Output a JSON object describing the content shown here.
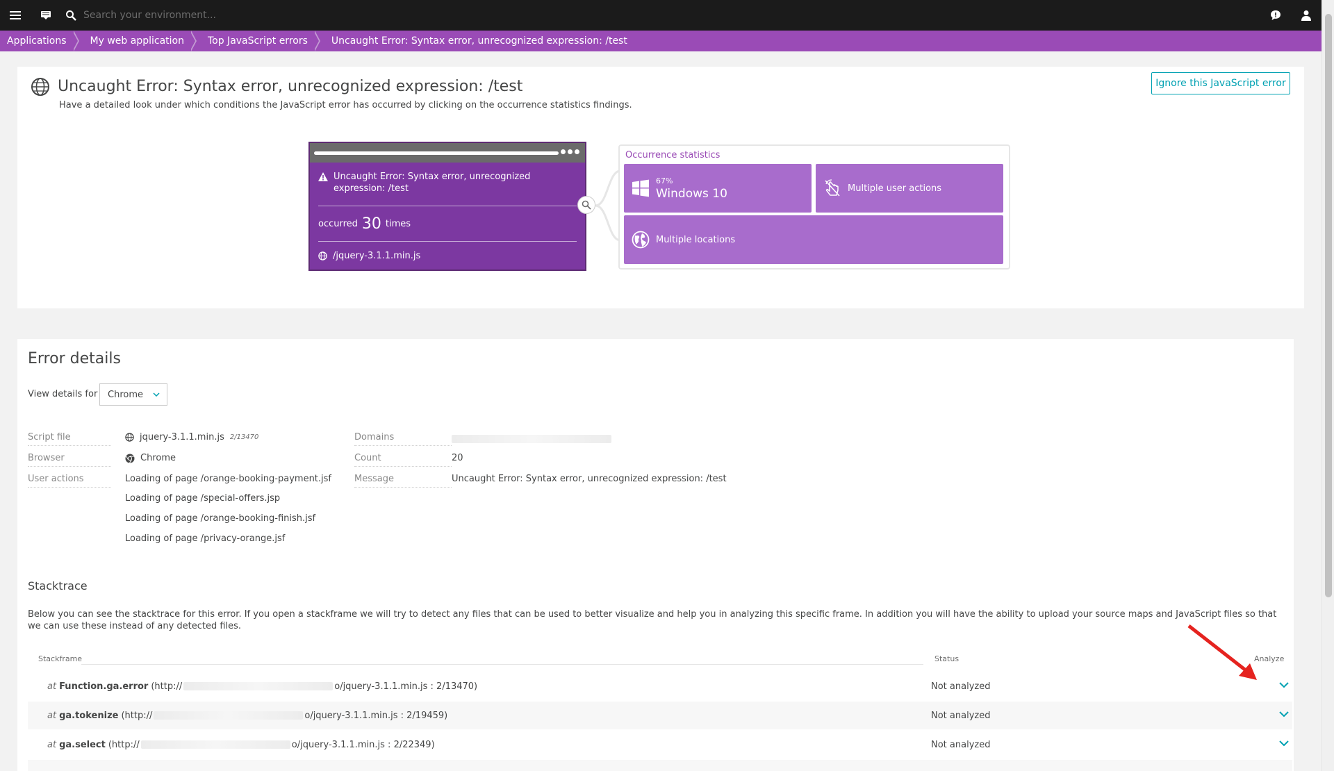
{
  "topbar": {
    "search_placeholder": "Search your environment..."
  },
  "breadcrumb": [
    "Applications",
    "My web application",
    "Top JavaScript errors",
    "Uncaught Error: Syntax error, unrecognized expression: /test"
  ],
  "hero": {
    "title": "Uncaught Error: Syntax error, unrecognized expression: /test",
    "subtitle": "Have a detailed look under which conditions the JavaScript error has occurred by clicking on the occurrence statistics findings.",
    "ignore_label": "Ignore this JavaScript error"
  },
  "browser": {
    "error_text": "Uncaught Error: Syntax error, unrecognized expression: /test",
    "occurred_prefix": "occurred",
    "occurred_count": "30",
    "occurred_suffix": "times",
    "file": "/jquery-3.1.1.min.js"
  },
  "occurrence": {
    "title": "Occurrence statistics",
    "os_percent": "67%",
    "os_name": "Windows 10",
    "user_actions": "Multiple user actions",
    "locations": "Multiple locations"
  },
  "details": {
    "title": "Error details",
    "view_label": "View details for",
    "browser_select": "Chrome",
    "script_file_label": "Script file",
    "script_file": "jquery-3.1.1.min.js",
    "script_file_pos": "2/13470",
    "browser_label": "Browser",
    "browser": "Chrome",
    "user_actions_label": "User actions",
    "user_actions": [
      "Loading of page /orange-booking-payment.jsf",
      "Loading of page /special-offers.jsp",
      "Loading of page /orange-booking-finish.jsf",
      "Loading of page /privacy-orange.jsf"
    ],
    "domains_label": "Domains",
    "count_label": "Count",
    "count": "20",
    "message_label": "Message",
    "message": "Uncaught Error: Syntax error, unrecognized expression: /test"
  },
  "stacktrace": {
    "title": "Stacktrace",
    "description": "Below you can see the stacktrace for this error. If you open a stackframe we will try to detect any files that can be used to better visualize and help you in analyzing this specific frame. In addition you will have the ability to upload your source maps and JavaScript files so that we can use these instead of any detected files.",
    "col_frame": "Stackframe",
    "col_status": "Status",
    "col_analyze": "Analyze",
    "rows": [
      {
        "at": "at",
        "fn": "Function.ga.error",
        "pre": "(http://",
        "post": "o/jquery-3.1.1.min.js : 2/13470)",
        "status": "Not analyzed"
      },
      {
        "at": "at",
        "fn": "ga.tokenize",
        "pre": "(http://",
        "post": "o/jquery-3.1.1.min.js : 2/19459)",
        "status": "Not analyzed"
      },
      {
        "at": "at",
        "fn": "ga.select",
        "pre": "(http://",
        "post": "o/jquery-3.1.1.min.js : 2/22349)",
        "status": "Not analyzed"
      }
    ]
  },
  "colors": {
    "topbar": "#1b1b1b",
    "breadcrumb": "#9a4bb6",
    "browser_card": "#7c38a1",
    "tile": "#a86ccc",
    "accent": "#00a1b2",
    "arrow": "#e5231f"
  }
}
